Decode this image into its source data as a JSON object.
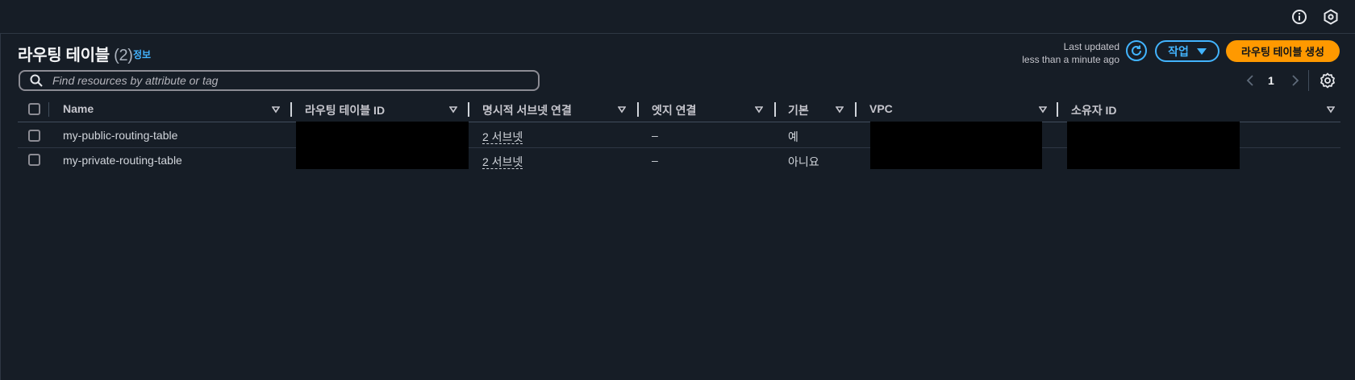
{
  "header": {
    "info_icon": "info-icon",
    "notification_icon": "notification-settings-icon"
  },
  "page": {
    "title": "라우팅 테이블",
    "count": "(2)",
    "info_link": "정보",
    "last_updated_label": "Last updated",
    "last_updated_value": "less than a minute ago",
    "actions_label": "작업",
    "create_label": "라우팅 테이블 생성"
  },
  "search": {
    "placeholder": "Find resources by attribute or tag",
    "value": ""
  },
  "pagination": {
    "current_page": "1"
  },
  "table": {
    "columns": [
      "Name",
      "라우팅 테이블 ID",
      "명시적 서브넷 연결",
      "엣지 연결",
      "기본",
      "VPC",
      "소유자 ID"
    ],
    "rows": [
      {
        "name": "my-public-routing-table",
        "route_table_id": "",
        "explicit_subnet": "2 서브넷",
        "edge": "–",
        "main": "예",
        "vpc": "",
        "owner": ""
      },
      {
        "name": "my-private-routing-table",
        "route_table_id": "",
        "explicit_subnet": "2 서브넷",
        "edge": "–",
        "main": "아니요",
        "vpc": "",
        "owner": ""
      }
    ]
  },
  "colors": {
    "background": "#161d26",
    "accent": "#42b4ff",
    "primary_button": "#ff9900"
  }
}
